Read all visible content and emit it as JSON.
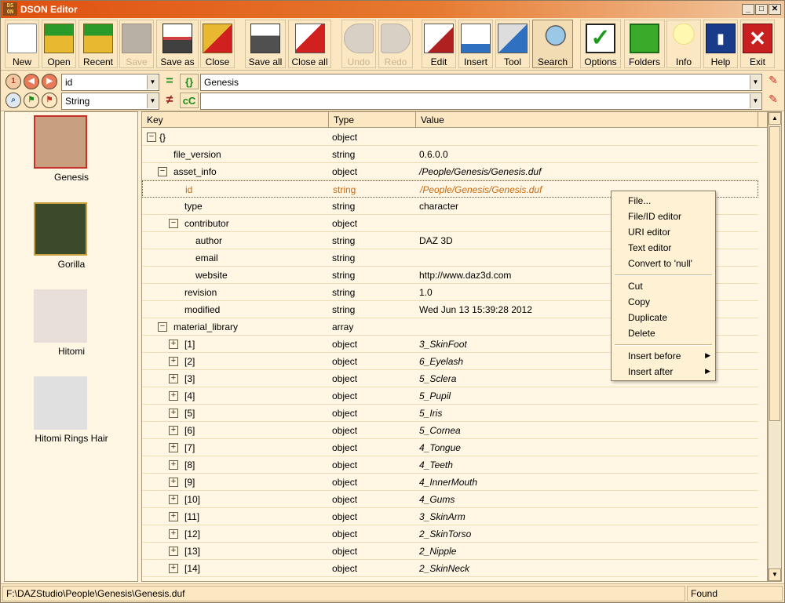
{
  "window": {
    "title": "DSON Editor",
    "logo_text": "DS ON"
  },
  "toolbar": [
    {
      "label": "New",
      "icon": "new-file-icon",
      "disabled": false
    },
    {
      "label": "Open",
      "icon": "open-folder-icon",
      "disabled": false
    },
    {
      "label": "Recent",
      "icon": "recent-folder-icon",
      "disabled": false
    },
    {
      "label": "Save",
      "icon": "save-disk-icon",
      "disabled": true
    },
    {
      "label": "Save as",
      "icon": "save-as-disk-icon",
      "disabled": false
    },
    {
      "label": "Close",
      "icon": "close-folder-icon",
      "disabled": false
    },
    {
      "label": "Save all",
      "icon": "save-all-icon",
      "disabled": false
    },
    {
      "label": "Close all",
      "icon": "close-all-icon",
      "disabled": false
    },
    {
      "label": "Undo",
      "icon": "undo-arrow-icon",
      "disabled": true
    },
    {
      "label": "Redo",
      "icon": "redo-arrow-icon",
      "disabled": true
    },
    {
      "label": "Edit",
      "icon": "edit-pencil-icon",
      "disabled": false
    },
    {
      "label": "Insert",
      "icon": "insert-page-icon",
      "disabled": false
    },
    {
      "label": "Tool",
      "icon": "wrench-tool-icon",
      "disabled": false
    },
    {
      "label": "Search",
      "icon": "magnifier-icon",
      "disabled": false,
      "active": true
    },
    {
      "label": "Options",
      "icon": "checkmark-icon",
      "disabled": false
    },
    {
      "label": "Folders",
      "icon": "green-cube-icon",
      "disabled": false
    },
    {
      "label": "Info",
      "icon": "lightbulb-icon",
      "disabled": false
    },
    {
      "label": "Help",
      "icon": "help-book-icon",
      "disabled": false
    },
    {
      "label": "Exit",
      "icon": "exit-x-icon",
      "disabled": false
    }
  ],
  "search": {
    "field_select": "id",
    "value_input": "Genesis",
    "type_select": "String",
    "second_input": "",
    "btn_equals": "=",
    "btn_braces": "{}",
    "btn_not_equals": "≠",
    "btn_case": "cC"
  },
  "figures": [
    {
      "name": "Genesis"
    },
    {
      "name": "Gorilla"
    },
    {
      "name": "Hitomi"
    },
    {
      "name": "Hitomi Rings Hair"
    }
  ],
  "tree": {
    "columns": [
      "Key",
      "Type",
      "Value"
    ],
    "rows": [
      {
        "key": "{}",
        "type": "object",
        "value": "",
        "indent": 0,
        "exp": "minus"
      },
      {
        "key": "file_version",
        "type": "string",
        "value": "0.6.0.0",
        "indent": 1,
        "exp": ""
      },
      {
        "key": "asset_info",
        "type": "object",
        "value": "/People/Genesis/Genesis.duf",
        "indent": 1,
        "exp": "minus",
        "italic": true
      },
      {
        "key": "id",
        "type": "string",
        "value": "/People/Genesis/Genesis.duf",
        "indent": 2,
        "exp": "",
        "selected": true
      },
      {
        "key": "type",
        "type": "string",
        "value": "character",
        "indent": 2,
        "exp": ""
      },
      {
        "key": "contributor",
        "type": "object",
        "value": "",
        "indent": 2,
        "exp": "minus"
      },
      {
        "key": "author",
        "type": "string",
        "value": "DAZ 3D",
        "indent": 3,
        "exp": ""
      },
      {
        "key": "email",
        "type": "string",
        "value": "",
        "indent": 3,
        "exp": ""
      },
      {
        "key": "website",
        "type": "string",
        "value": "http://www.daz3d.com",
        "indent": 3,
        "exp": ""
      },
      {
        "key": "revision",
        "type": "string",
        "value": "1.0",
        "indent": 2,
        "exp": ""
      },
      {
        "key": "modified",
        "type": "string",
        "value": "Wed Jun 13 15:39:28 2012",
        "indent": 2,
        "exp": ""
      },
      {
        "key": "material_library",
        "type": "array",
        "value": "",
        "indent": 1,
        "exp": "minus"
      },
      {
        "key": "[1]",
        "type": "object",
        "value": "3_SkinFoot",
        "indent": 2,
        "exp": "plus",
        "italic": true
      },
      {
        "key": "[2]",
        "type": "object",
        "value": "6_Eyelash",
        "indent": 2,
        "exp": "plus",
        "italic": true
      },
      {
        "key": "[3]",
        "type": "object",
        "value": "5_Sclera",
        "indent": 2,
        "exp": "plus",
        "italic": true
      },
      {
        "key": "[4]",
        "type": "object",
        "value": "5_Pupil",
        "indent": 2,
        "exp": "plus",
        "italic": true
      },
      {
        "key": "[5]",
        "type": "object",
        "value": "5_Iris",
        "indent": 2,
        "exp": "plus",
        "italic": true
      },
      {
        "key": "[6]",
        "type": "object",
        "value": "5_Cornea",
        "indent": 2,
        "exp": "plus",
        "italic": true
      },
      {
        "key": "[7]",
        "type": "object",
        "value": "4_Tongue",
        "indent": 2,
        "exp": "plus",
        "italic": true
      },
      {
        "key": "[8]",
        "type": "object",
        "value": "4_Teeth",
        "indent": 2,
        "exp": "plus",
        "italic": true
      },
      {
        "key": "[9]",
        "type": "object",
        "value": "4_InnerMouth",
        "indent": 2,
        "exp": "plus",
        "italic": true
      },
      {
        "key": "[10]",
        "type": "object",
        "value": "4_Gums",
        "indent": 2,
        "exp": "plus",
        "italic": true
      },
      {
        "key": "[11]",
        "type": "object",
        "value": "3_SkinArm",
        "indent": 2,
        "exp": "plus",
        "italic": true
      },
      {
        "key": "[12]",
        "type": "object",
        "value": "2_SkinTorso",
        "indent": 2,
        "exp": "plus",
        "italic": true
      },
      {
        "key": "[13]",
        "type": "object",
        "value": "2_Nipple",
        "indent": 2,
        "exp": "plus",
        "italic": true
      },
      {
        "key": "[14]",
        "type": "object",
        "value": "2_SkinNeck",
        "indent": 2,
        "exp": "plus",
        "italic": true
      }
    ]
  },
  "context_menu": [
    {
      "label": "File...",
      "submenu": false
    },
    {
      "label": "File/ID editor",
      "submenu": false
    },
    {
      "label": "URI editor",
      "submenu": false
    },
    {
      "label": "Text editor",
      "submenu": false
    },
    {
      "label": "Convert to 'null'",
      "submenu": false
    },
    {
      "sep": true
    },
    {
      "label": "Cut",
      "submenu": false
    },
    {
      "label": "Copy",
      "submenu": false
    },
    {
      "label": "Duplicate",
      "submenu": false
    },
    {
      "label": "Delete",
      "submenu": false
    },
    {
      "sep": true
    },
    {
      "label": "Insert before",
      "submenu": true
    },
    {
      "label": "Insert after",
      "submenu": true
    }
  ],
  "status": {
    "path": "F:\\DAZStudio\\People\\Genesis\\Genesis.duf",
    "result": "Found"
  }
}
